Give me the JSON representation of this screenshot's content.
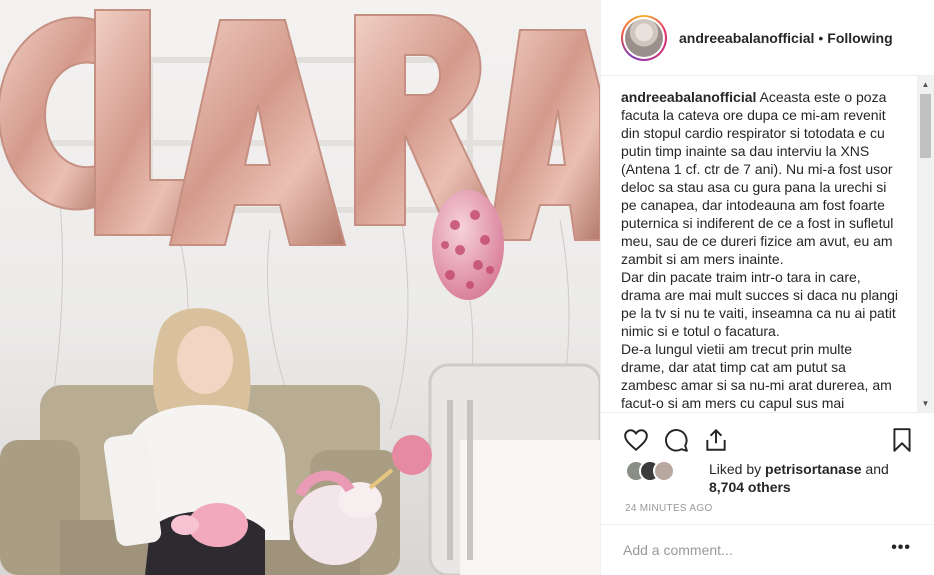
{
  "post": {
    "username": "andreeabalanofficial",
    "separator": "•",
    "follow_status": "Following",
    "caption_user": "andreeabalanofficial",
    "caption_text": "Aceasta este o poza facuta la cateva ore dupa ce mi-am revenit din stopul cardio respirator si totodata e cu putin timp inainte sa dau interviu la XNS (Antena 1 cf. ctr de 7 ani). Nu mi-a fost usor deloc sa stau asa cu gura pana la urechi si pe canapea, dar intodeauna am fost foarte puternica si indiferent de ce a fost in sufletul meu, sau de ce dureri fizice am avut, eu am zambit si am mers inainte.",
    "caption_text_2": "Dar din pacate traim intr-o tara in care, drama are mai mult succes si daca nu plangi pe la tv si nu te vaiti, inseamna ca nu ai patit nimic si e totul o facatura.",
    "caption_text_3": "De-a lungul vietii am trecut prin multe drame, dar atat timp cat am putut sa zambesc amar si sa nu-mi arat durerea, am facut-o si am mers cu capul sus mai",
    "liked_by_prefix": "Liked by",
    "liked_by_user": "petrisortanase",
    "liked_by_and": "and",
    "likes_others": "8,704 others",
    "timestamp": "24 MINUTES AGO",
    "comment_placeholder": "Add a comment...",
    "more_options": "•••"
  },
  "photo": {
    "balloon_text": "CLARA"
  },
  "icons": {
    "like": "heart-icon",
    "comment": "comment-icon",
    "share": "share-icon",
    "save": "bookmark-icon",
    "scroll_up": "▲",
    "scroll_down": "▼"
  },
  "colors": {
    "balloon": "#d9a79a",
    "balloon_shade": "#b97d72",
    "text": "#262626",
    "muted": "#999999",
    "border": "#efefef"
  }
}
